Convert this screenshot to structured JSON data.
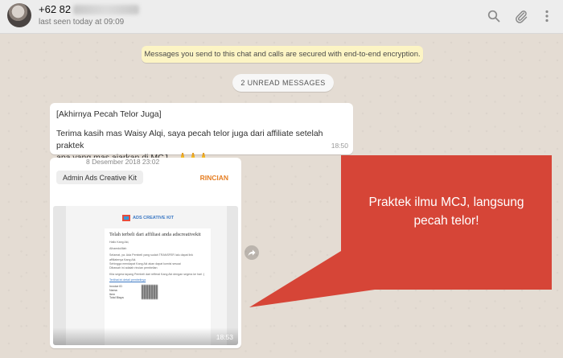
{
  "header": {
    "contact_name": "+62 82",
    "last_seen": "last seen today at 09:09",
    "icons": [
      "search-icon",
      "attach-icon",
      "menu-icon"
    ]
  },
  "system": {
    "encryption_notice": "Messages you send to this chat and calls are secured with end-to-end encryption.",
    "unread_badge": "2 UNREAD MESSAGES"
  },
  "messages": [
    {
      "title_line": "[Akhirnya Pecah Telor Juga]",
      "body_line1": "Terima kasih mas Waisy Alqi, saya pecah telor juga dari affiliate setelah praktek",
      "body_line2": "apa yang mas ajarkan di MCJ... 🙏🙏🙏",
      "time": "18:50"
    },
    {
      "doc_date": "8 Desember 2018 23:02",
      "doc_title": "Admin Ads Creative Kit",
      "doc_action": "RINCIAN",
      "email": {
        "logo": "ADS CREATIVE KIT",
        "heading": "Telah terbeli dari affiliasi anda adscreativekit",
        "greeting": "Hallo Kang Aki,",
        "line1": "Alhamdulillah",
        "line2": "Selamat, ya. Ada Pembeli yang sudah TRANSFER lalu dapat link affiliatenya Kang Aki.",
        "line3": "Sehingga mendapat Kang Aki akan dapat komisi sesuai",
        "line4": "Dibawah ini adalah rincian pembelian",
        "line5": "Kita segera tayang Pembeli dari refferal Kang Aki dengan segera ke hari :)",
        "link": "Terlihat ini detail pembelinya",
        "fields": [
          "Invoice ID",
          "Nama",
          "Item",
          "Total Biaya"
        ]
      },
      "time": "18:53"
    }
  ],
  "annotation": {
    "text_line1": "Praktek ilmu MCJ, langsung",
    "text_line2": "pecah telor!",
    "color": "#d64537"
  },
  "colors": {
    "chat_background": "#e4dcd3",
    "header_background": "#ededed",
    "encryption_background": "#fcf4c4",
    "action_orange": "#e67e22"
  }
}
